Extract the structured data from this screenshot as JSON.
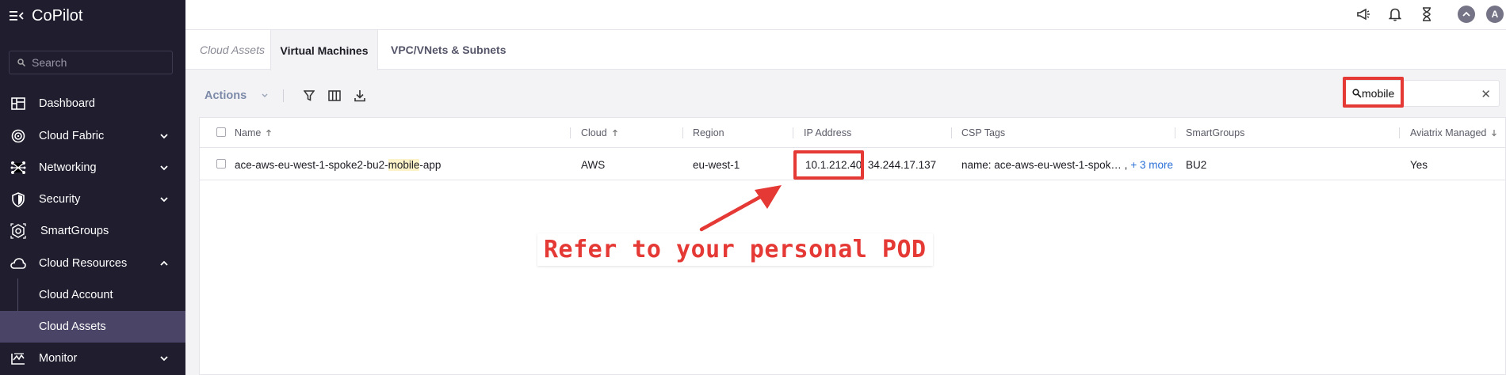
{
  "app": {
    "title": "CoPilot"
  },
  "sidebar": {
    "search_placeholder": "Search",
    "items": [
      {
        "label": "Dashboard",
        "icon": "dashboard-icon"
      },
      {
        "label": "Cloud Fabric",
        "icon": "cloud-fabric-icon",
        "chevron": "down"
      },
      {
        "label": "Networking",
        "icon": "networking-icon",
        "chevron": "down"
      },
      {
        "label": "Security",
        "icon": "shield-icon",
        "chevron": "down"
      },
      {
        "label": "SmartGroups",
        "icon": "smartgroups-icon"
      },
      {
        "label": "Cloud Resources",
        "icon": "cloud-icon",
        "chevron": "up"
      },
      {
        "label": "Monitor",
        "icon": "monitor-icon",
        "chevron": "down"
      }
    ],
    "sub_items": [
      {
        "label": "Cloud Account",
        "active": false
      },
      {
        "label": "Cloud Assets",
        "active": true
      }
    ]
  },
  "topbar": {
    "icons": [
      "megaphone-icon",
      "bell-icon",
      "hourglass-icon",
      "chevron-up-circle-icon",
      "avatar"
    ],
    "avatar_initial": "A"
  },
  "tabs": [
    {
      "label": "Cloud Assets",
      "active": false
    },
    {
      "label": "Virtual Machines",
      "active": true
    },
    {
      "label": "VPC/VNets & Subnets",
      "active": false
    }
  ],
  "toolbar": {
    "actions_label": "Actions",
    "icons": [
      "filter-icon",
      "columns-icon",
      "download-icon"
    ],
    "search_value": "mobile",
    "clear_icon": "close-icon"
  },
  "table": {
    "columns": [
      {
        "label": "Name",
        "sort": "up"
      },
      {
        "label": "Cloud",
        "sort": "up"
      },
      {
        "label": "Region"
      },
      {
        "label": "IP Address"
      },
      {
        "label": "CSP Tags"
      },
      {
        "label": "SmartGroups"
      },
      {
        "label": "Aviatrix Managed",
        "sort": "down"
      }
    ],
    "rows": [
      {
        "name_prefix": "ace-aws-eu-west-1-spoke2-bu2-",
        "name_match": "mobile",
        "name_suffix": "-app",
        "cloud": "AWS",
        "region": "eu-west-1",
        "ip_primary": "10.1.212.40",
        "ip_rest": ", 34.244.17.137",
        "csp_tags": "name: ace-aws-eu-west-1-spok… ,",
        "csp_more": "+ 3 more",
        "smartgroups": "BU2",
        "aviatrix_managed": "Yes"
      }
    ]
  },
  "annotation": {
    "callout_text": "Refer to your personal POD",
    "color": "#e53935"
  }
}
